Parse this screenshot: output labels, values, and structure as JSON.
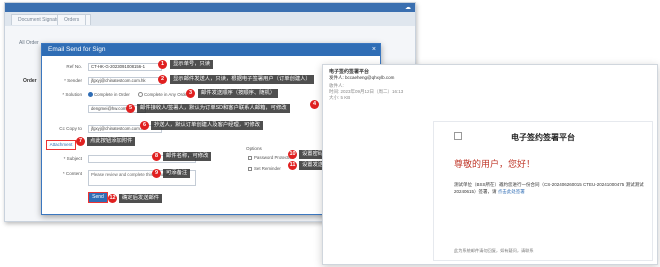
{
  "app": {
    "tabs": [
      "Document Signature Platform",
      "Orders"
    ],
    "side_labels": [
      "All Order",
      "Order"
    ]
  },
  "dialog": {
    "title": "Email Send for Sign",
    "fields": {
      "ref_label": "Ref No.",
      "ref_value": "CT-HK-G-2023091008156-1",
      "sender_label": "* Sender",
      "sender_value": "jfgxyj@chinatestcom.com.hk",
      "solution_label": "* Solution",
      "solution_options": [
        "Complete in Order",
        "Complete in Any Order"
      ],
      "recipient_value": "dengmei@hw.com.hk",
      "cc_label": "Cc Copy to",
      "cc_value": "jfgxyj@chinatestcom.com.hk",
      "attachment_label": "Attachment",
      "subject_label": "* Subject",
      "content_label": "* Content",
      "content_value": "Please review and complete this document.",
      "options_title": "Options",
      "option_password": "Password Protection",
      "option_reminder": "Set Reminder",
      "send_label": "Send"
    }
  },
  "annotations": [
    {
      "n": "1",
      "text": "显示单号，只读"
    },
    {
      "n": "2",
      "text": "显示邮件发送人，只读，根据电子签署用户（订单创建人）"
    },
    {
      "n": "3",
      "text": "邮件发送顺序（按顺序、随机）"
    },
    {
      "n": "4",
      "text": "邮件接收人/签署人，默认为订单SD和客户联系人邮箱，可修改"
    },
    {
      "n": "5",
      "text": ""
    },
    {
      "n": "6",
      "text": "抄送人，默认订单创建人及客户经理，可修改"
    },
    {
      "n": "7",
      "text": "点此按钮添加附件"
    },
    {
      "n": "8",
      "text": "邮件名称，可修改"
    },
    {
      "n": "9",
      "text": "可添备注"
    },
    {
      "n": "10",
      "text": "设置密码"
    },
    {
      "n": "11",
      "text": "设置发送"
    },
    {
      "n": "12",
      "text": "确定后发送邮件"
    }
  ],
  "mail": {
    "subject": "电子签约签署平台",
    "from_line": "发件人: bccaeheng@qhxylb.com",
    "to_line": "收件人: ",
    "time_line": "时间: 2023年09月12日（周二）16:13",
    "size_line": "大小: 5 KB",
    "brand": "电子签约签署平台",
    "greeting": "尊敬的用户，您好！",
    "body": "测试单位（BSS所在）邀约您进行一份合同（CS-202406260015 CTEU-20241000475 测试测试20240615）签署，请",
    "link": "点击此处签署",
    "footer": "此为系统邮件请勿回复，如有疑问，请联系"
  }
}
